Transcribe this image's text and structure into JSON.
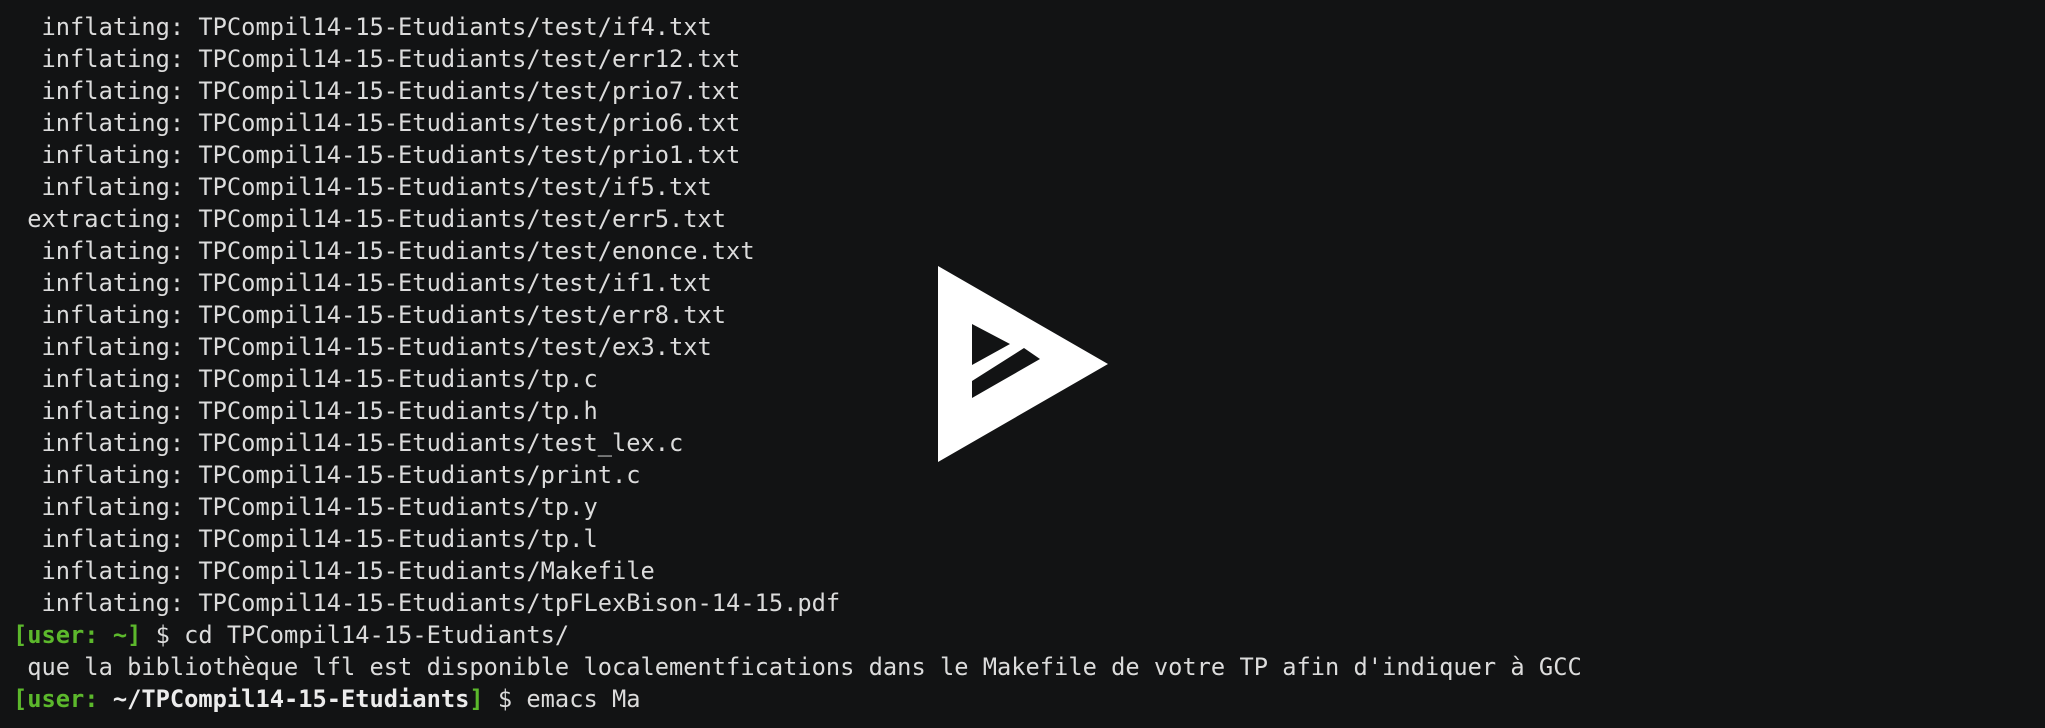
{
  "colors": {
    "background": "#121314",
    "text": "#dcdcdc",
    "prompt": "#5cb82c",
    "play_icon": "#ffffff"
  },
  "output_lines": [
    "  inflating: TPCompil14-15-Etudiants/test/if4.txt",
    "  inflating: TPCompil14-15-Etudiants/test/err12.txt",
    "  inflating: TPCompil14-15-Etudiants/test/prio7.txt",
    "  inflating: TPCompil14-15-Etudiants/test/prio6.txt",
    "  inflating: TPCompil14-15-Etudiants/test/prio1.txt",
    "  inflating: TPCompil14-15-Etudiants/test/if5.txt",
    " extracting: TPCompil14-15-Etudiants/test/err5.txt",
    "  inflating: TPCompil14-15-Etudiants/test/enonce.txt",
    "  inflating: TPCompil14-15-Etudiants/test/if1.txt",
    "  inflating: TPCompil14-15-Etudiants/test/err8.txt",
    "  inflating: TPCompil14-15-Etudiants/test/ex3.txt",
    "  inflating: TPCompil14-15-Etudiants/tp.c",
    "  inflating: TPCompil14-15-Etudiants/tp.h",
    "  inflating: TPCompil14-15-Etudiants/test_lex.c",
    "  inflating: TPCompil14-15-Etudiants/print.c",
    "  inflating: TPCompil14-15-Etudiants/tp.y",
    "  inflating: TPCompil14-15-Etudiants/tp.l",
    "  inflating: TPCompil14-15-Etudiants/Makefile",
    "  inflating: TPCompil14-15-Etudiants/tpFLexBison-14-15.pdf"
  ],
  "prompt1": {
    "user_prefix": "[user: ",
    "path": "~",
    "close": "]",
    "command": " $ cd TPCompil14-15-Etudiants/"
  },
  "wrapped_line": " que la bibliothèque lfl est disponible localementfications dans le Makefile de votre TP afin d'indiquer à GCC",
  "prompt2": {
    "user_prefix": "[user: ",
    "path": "~/TPCompil14-15-Etudiants",
    "close": "]",
    "command": " $ emacs Ma"
  },
  "overlay": {
    "icon": "asciinema-play-icon"
  }
}
